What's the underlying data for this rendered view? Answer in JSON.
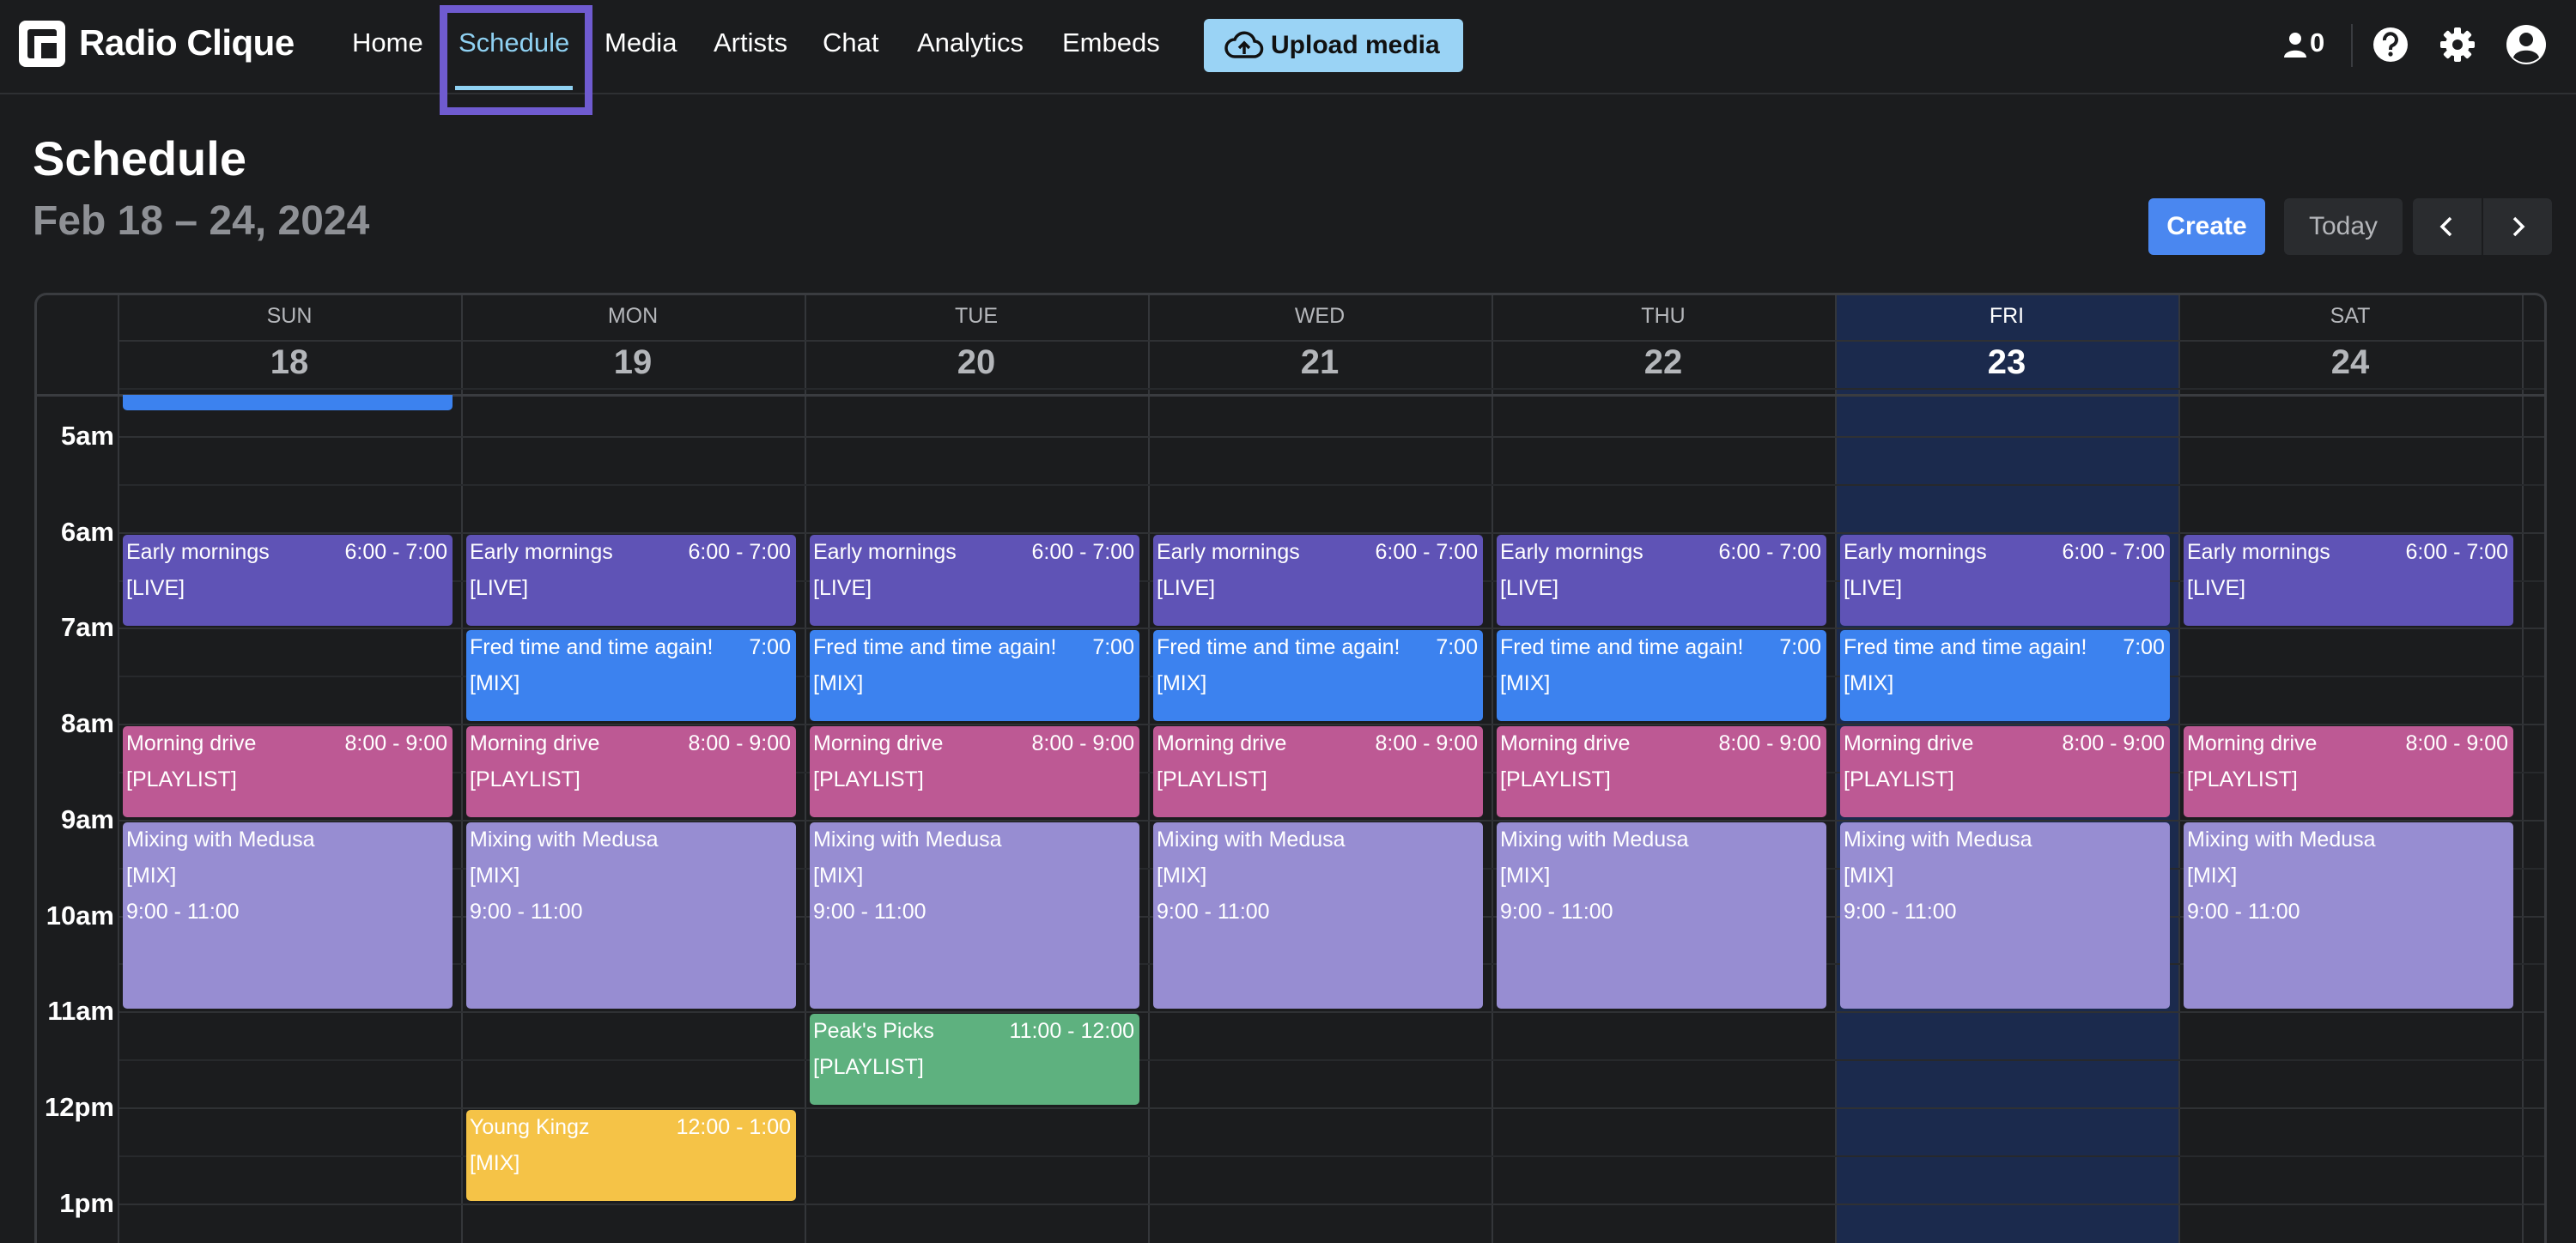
{
  "app": {
    "brand": "Radio Clique"
  },
  "nav": {
    "links": [
      "Home",
      "Schedule",
      "Media",
      "Artists",
      "Chat",
      "Analytics",
      "Embeds"
    ],
    "active": "Schedule",
    "upload_label": "Upload media",
    "listener_count": "0",
    "icons": [
      "user-icon",
      "help-icon",
      "gear-icon",
      "account-icon"
    ]
  },
  "header": {
    "title": "Schedule",
    "date_range": "Feb 18 – 24, 2024",
    "create_label": "Create",
    "today_label": "Today"
  },
  "days": [
    {
      "name": "SUN",
      "num": "18"
    },
    {
      "name": "MON",
      "num": "19"
    },
    {
      "name": "TUE",
      "num": "20"
    },
    {
      "name": "WED",
      "num": "21"
    },
    {
      "name": "THU",
      "num": "22"
    },
    {
      "name": "FRI",
      "num": "23",
      "today": true
    },
    {
      "name": "SAT",
      "num": "24"
    }
  ],
  "hours": [
    "5am",
    "6am",
    "7am",
    "8am",
    "9am",
    "10am",
    "11am",
    "12pm",
    "1pm"
  ],
  "event_types": {
    "live": {
      "title": "Early mornings",
      "time": "6:00 - 7:00",
      "tag": "[LIVE]",
      "color": "#5f53b6"
    },
    "fred": {
      "title": "Fred time and time again!",
      "time": "7:00",
      "tag": "[MIX]",
      "color": "#3c82ef"
    },
    "drive": {
      "title": "Morning drive",
      "time": "8:00 - 9:00",
      "tag": "[PLAYLIST]",
      "color": "#bd5994"
    },
    "medusa": {
      "title": "Mixing with Medusa",
      "time": "9:00 - 11:00",
      "tag": "[MIX]",
      "color": "#978dd2"
    },
    "peak": {
      "title": "Peak's Picks",
      "time": "11:00 - 12:00",
      "tag": "[PLAYLIST]",
      "color": "#5eb17f"
    },
    "kingz": {
      "title": "Young Kingz",
      "time": "12:00 - 1:00",
      "tag": "[MIX]",
      "color": "#f5c347"
    }
  },
  "schedule": [
    {
      "day": 0,
      "events": [
        "live",
        "drive",
        "medusa"
      ]
    },
    {
      "day": 1,
      "events": [
        "live",
        "fred",
        "drive",
        "medusa",
        "kingz"
      ]
    },
    {
      "day": 2,
      "events": [
        "live",
        "fred",
        "drive",
        "medusa",
        "peak"
      ]
    },
    {
      "day": 3,
      "events": [
        "live",
        "fred",
        "drive",
        "medusa"
      ]
    },
    {
      "day": 4,
      "events": [
        "live",
        "fred",
        "drive",
        "medusa"
      ]
    },
    {
      "day": 5,
      "events": [
        "live",
        "fred",
        "drive",
        "medusa"
      ]
    },
    {
      "day": 6,
      "events": [
        "live",
        "drive",
        "medusa"
      ]
    }
  ]
}
